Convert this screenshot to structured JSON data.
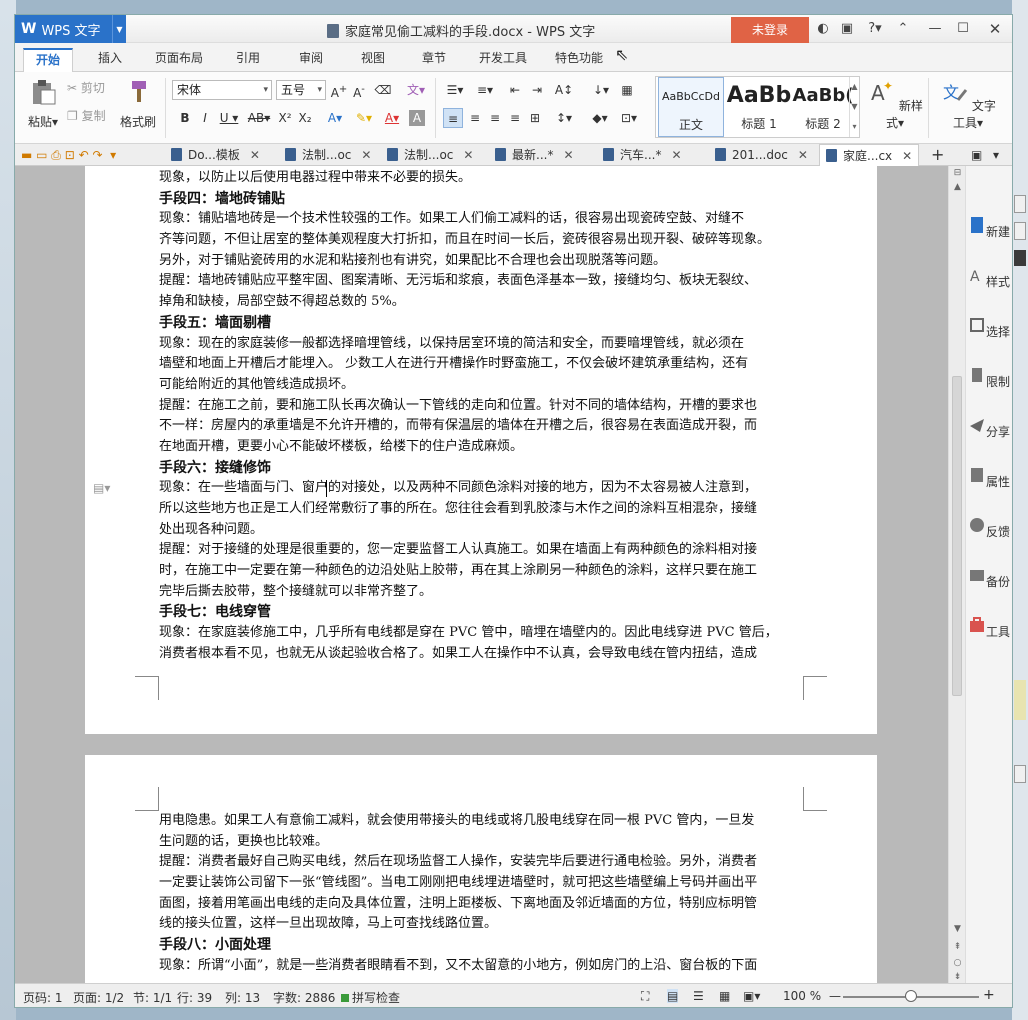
{
  "app": {
    "name": "WPS 文字",
    "doc_title": "家庭常见偷工减料的手段.docx - WPS 文字",
    "login": "未登录"
  },
  "menu_tabs": [
    "开始",
    "插入",
    "页面布局",
    "引用",
    "审阅",
    "视图",
    "章节",
    "开发工具",
    "特色功能"
  ],
  "toolbar": {
    "paste": "粘贴",
    "cut": "剪切",
    "copy": "复制",
    "format_painter": "格式刷",
    "font": "宋体",
    "size": "五号",
    "styles": [
      {
        "preview": "AaBbCcDd",
        "label": "正文"
      },
      {
        "preview": "AaBb",
        "label": "标题 1"
      },
      {
        "preview": "AaBb(",
        "label": "标题 2"
      }
    ],
    "new_style": "新样式",
    "text_tools": "文字工具"
  },
  "file_tabs": [
    "Do...模板",
    "法制...oc",
    "法制...oc",
    "最新...*",
    "汽车...*",
    "201...doc",
    "家庭...cx"
  ],
  "page1_lines": [
    {
      "t": "现象，以防止以后使用电器过程中带来不必要的损失。",
      "h": false
    },
    {
      "t": "手段四：墙地砖铺贴",
      "h": true
    },
    {
      "t": "  现象：铺贴墙地砖是一个技术性较强的工作。如果工人们偷工减料的话，很容易出现瓷砖空鼓、对缝不",
      "h": false
    },
    {
      "t": "齐等问题，不但让居室的整体美观程度大打折扣，而且在时间一长后，瓷砖很容易出现开裂、破碎等现象。",
      "h": false
    },
    {
      "t": "另外，对于铺贴瓷砖用的水泥和粘接剂也有讲究，如果配比不合理也会出现脱落等问题。",
      "h": false
    },
    {
      "t": "提醒：墙地砖铺贴应平整牢固、图案清晰、无污垢和浆痕，表面色泽基本一致，接缝均匀、板块无裂纹、",
      "h": false
    },
    {
      "t": "掉角和缺棱，局部空鼓不得超总数的 5%。",
      "h": false
    },
    {
      "t": "手段五：墙面剔槽",
      "h": true
    },
    {
      "t": "  现象：现在的家庭装修一般都选择暗埋管线，以保持居室环境的简洁和安全，而要暗埋管线，就必须在",
      "h": false
    },
    {
      "t": "墙壁和地面上开槽后才能埋入。 少数工人在进行开槽操作时野蛮施工，不仅会破坏建筑承重结构，还有",
      "h": false
    },
    {
      "t": "可能给附近的其他管线造成损坏。",
      "h": false
    },
    {
      "t": "提醒：在施工之前，要和施工队长再次确认一下管线的走向和位置。针对不同的墙体结构，开槽的要求也",
      "h": false
    },
    {
      "t": "不一样：房屋内的承重墙是不允许开槽的，而带有保温层的墙体在开槽之后，很容易在表面造成开裂，而",
      "h": false
    },
    {
      "t": "在地面开槽，更要小心不能破坏楼板，给楼下的住户造成麻烦。",
      "h": false
    },
    {
      "t": "手段六：接缝修饰",
      "h": true
    },
    {
      "t": "现象：在一些墙面与门、窗户的对接处，以及两种不同颜色涂料对接的地方，因为不太容易被人注意到，",
      "h": false
    },
    {
      "t": "所以这些地方也正是工人们经常敷衍了事的所在。您往往会看到乳胶漆与木作之间的涂料互相混杂，接缝",
      "h": false
    },
    {
      "t": "处出现各种问题。",
      "h": false
    },
    {
      "t": "提醒：对于接缝的处理是很重要的，您一定要监督工人认真施工。如果在墙面上有两种颜色的涂料相对接",
      "h": false
    },
    {
      "t": "时，在施工中一定要在第一种颜色的边沿处贴上胶带，再在其上涂刷另一种颜色的涂料，这样只要在施工",
      "h": false
    },
    {
      "t": "完毕后撕去胶带，整个接缝就可以非常齐整了。",
      "h": false
    },
    {
      "t": "手段七：电线穿管",
      "h": true
    },
    {
      "t": "  现象：在家庭装修施工中，几乎所有电线都是穿在 PVC 管中，暗埋在墙壁内的。因此电线穿进 PVC 管后，",
      "h": false
    },
    {
      "t": "消费者根本看不见，也就无从谈起验收合格了。如果工人在操作中不认真，会导致电线在管内扭结，造成",
      "h": false
    }
  ],
  "page2_lines": [
    {
      "t": "用电隐患。如果工人有意偷工减料，就会使用带接头的电线或将几股电线穿在同一根 PVC 管内，一旦发",
      "h": false
    },
    {
      "t": "生问题的话，更换也比较难。",
      "h": false
    },
    {
      "t": "提醒：消费者最好自己购买电线，然后在现场监督工人操作，安装完毕后要进行通电检验。另外，消费者",
      "h": false
    },
    {
      "t": "一定要让装饰公司留下一张“管线图”。当电工刚刚把电线埋进墙壁时，就可把这些墙壁编上号码并画出平",
      "h": false
    },
    {
      "t": "面图，接着用笔画出电线的走向及具体位置，注明上距楼板、下离地面及邻近墙面的方位，特别应标明管",
      "h": false
    },
    {
      "t": "线的接头位置，这样一旦出现故障，马上可查找线路位置。",
      "h": false
    },
    {
      "t": "手段八：小面处理",
      "h": true
    },
    {
      "t": "现象：所谓“小面”，就是一些消费者眼睛看不到，又不太留意的小地方，例如房门的上沿、窗台板的下面",
      "h": false
    }
  ],
  "right_panel": [
    "新建",
    "样式",
    "选择",
    "限制",
    "分享",
    "属性",
    "反馈",
    "备份",
    "工具"
  ],
  "status": {
    "page_code": "页码: 1",
    "pages": "页面: 1/2",
    "section": "节: 1/1",
    "row": "行: 39",
    "col": "列: 13",
    "words": "字数: 2886",
    "spell": "拼写检查",
    "zoom": "100 %"
  },
  "colors": {
    "accent": "#2a72c9",
    "login": "#e06345"
  }
}
